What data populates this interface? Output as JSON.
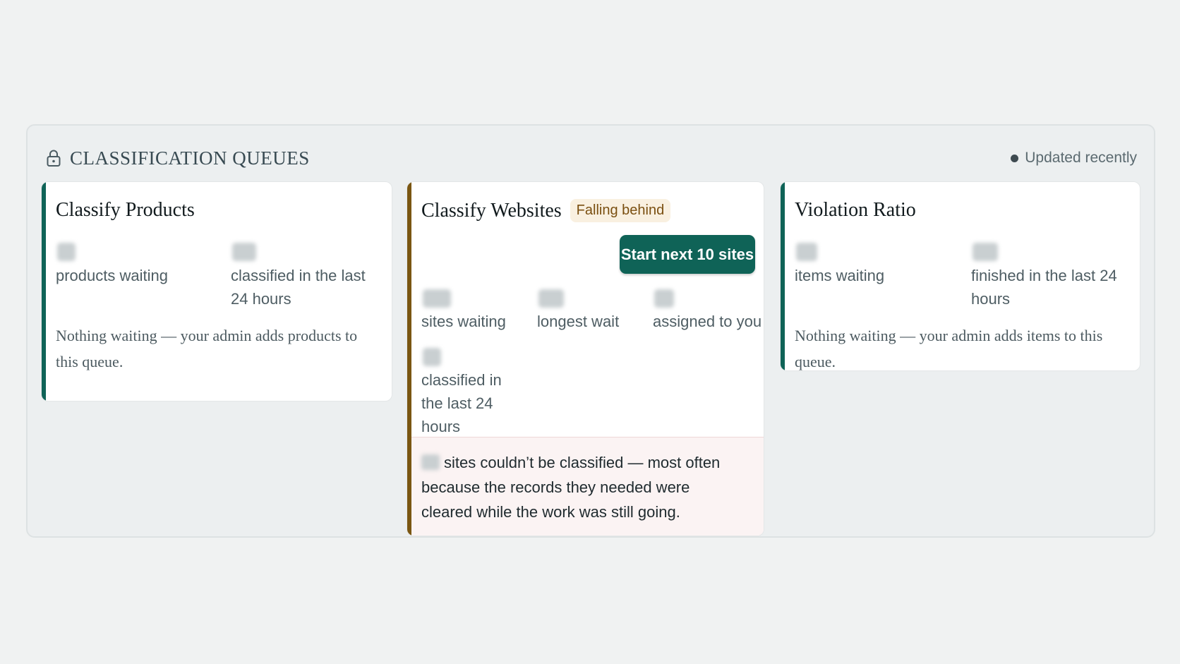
{
  "header": {
    "title": "CLASSIFICATION QUEUES",
    "status": "Updated recently",
    "icons": {
      "lock": "lock-icon",
      "status": "status-dot-icon"
    }
  },
  "cards": {
    "products": {
      "title": "Classify Products",
      "stats": [
        {
          "label": "products waiting"
        },
        {
          "label": "classified in the last 24 hours"
        }
      ],
      "note": "Nothing waiting — your admin adds products to this queue."
    },
    "websites": {
      "title": "Classify Websites",
      "badge": "Falling behind",
      "button": "Start next 10 sites",
      "stats": [
        {
          "label": "sites waiting"
        },
        {
          "label": "longest wait"
        },
        {
          "label": "assigned to you"
        },
        {
          "label": "classified in the last 24 hours"
        }
      ],
      "error": "sites couldn’t be classified — most often because the records they needed were cleared while the work was still going."
    },
    "violation": {
      "title": "Violation Ratio",
      "stats": [
        {
          "label": "items waiting"
        },
        {
          "label": "finished in the last 24 hours"
        }
      ],
      "note": "Nothing waiting — your admin adds items to this queue."
    }
  },
  "colors": {
    "accent_green": "#0f6357",
    "accent_amber": "#7a5612",
    "badge_bg": "#f9f0e0",
    "error_bg": "#fbf3f3"
  }
}
